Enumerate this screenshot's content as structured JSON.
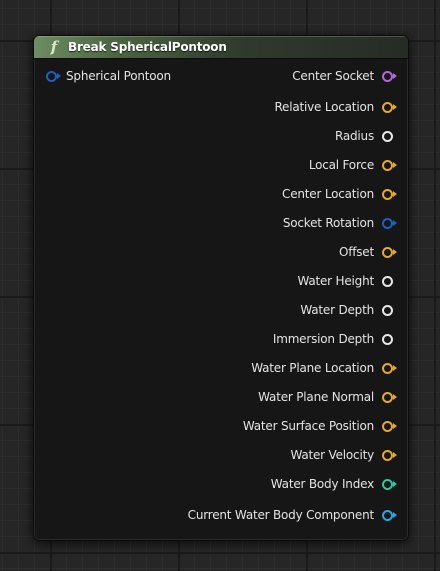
{
  "node": {
    "title": "Break SphericalPontoon",
    "icon": "function-icon",
    "input_pin": {
      "label": "Spherical Pontoon",
      "color": "#1f5fbf",
      "arrow": true
    },
    "output_pins": [
      {
        "label": "Center Socket",
        "color": "#b565e0",
        "arrow": true
      },
      {
        "label": "Relative Location",
        "color": "#e6a92a",
        "arrow": true
      },
      {
        "label": "Radius",
        "color": "#e8e8e8",
        "arrow": false
      },
      {
        "label": "Local Force",
        "color": "#e6a92a",
        "arrow": true
      },
      {
        "label": "Center Location",
        "color": "#e6a92a",
        "arrow": true
      },
      {
        "label": "Socket Rotation",
        "color": "#1f5fbf",
        "arrow": true
      },
      {
        "label": "Offset",
        "color": "#e6a92a",
        "arrow": true
      },
      {
        "label": "Water Height",
        "color": "#e8e8e8",
        "arrow": false
      },
      {
        "label": "Water Depth",
        "color": "#e8e8e8",
        "arrow": false
      },
      {
        "label": "Immersion Depth",
        "color": "#e8e8e8",
        "arrow": false
      },
      {
        "label": "Water Plane Location",
        "color": "#e6a92a",
        "arrow": true
      },
      {
        "label": "Water Plane Normal",
        "color": "#e6a92a",
        "arrow": true
      },
      {
        "label": "Water Surface Position",
        "color": "#e6a92a",
        "arrow": true
      },
      {
        "label": "Water Velocity",
        "color": "#e6a92a",
        "arrow": true
      },
      {
        "label": "Water Body Index",
        "color": "#2ec7a0",
        "arrow": true
      },
      {
        "label": "Current Water Body Component",
        "color": "#23a8e0",
        "arrow": true
      }
    ]
  }
}
